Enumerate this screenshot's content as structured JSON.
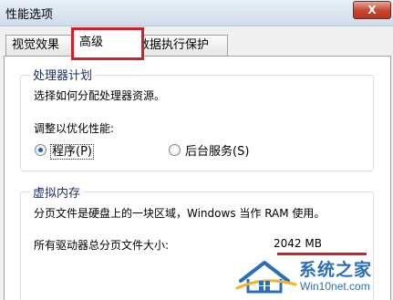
{
  "window": {
    "title": "性能选项",
    "close_label": "X"
  },
  "tabs": [
    {
      "label": "视觉效果"
    },
    {
      "label": "高级"
    },
    {
      "label": "数据执行保护"
    }
  ],
  "cpu_group": {
    "legend": "处理器计划",
    "description": "选择如何分配处理器资源。",
    "prompt": "调整以优化性能:",
    "options": [
      {
        "label": "程序(P)",
        "checked": true
      },
      {
        "label": "后台服务(S)",
        "checked": false
      }
    ]
  },
  "vm_group": {
    "legend": "虚拟内存",
    "description": "分页文件是硬盘上的一块区域，Windows 当作 RAM 使用。",
    "total_label": "所有驱动器总分页文件大小:",
    "total_value": "2042 MB"
  },
  "watermark": {
    "title": "系统之家",
    "url": "Win10net.com"
  },
  "colors": {
    "highlight_red": "#d0202a",
    "watermark_blue": "#2a6fb6",
    "legend_blue": "#1a2f6c"
  }
}
